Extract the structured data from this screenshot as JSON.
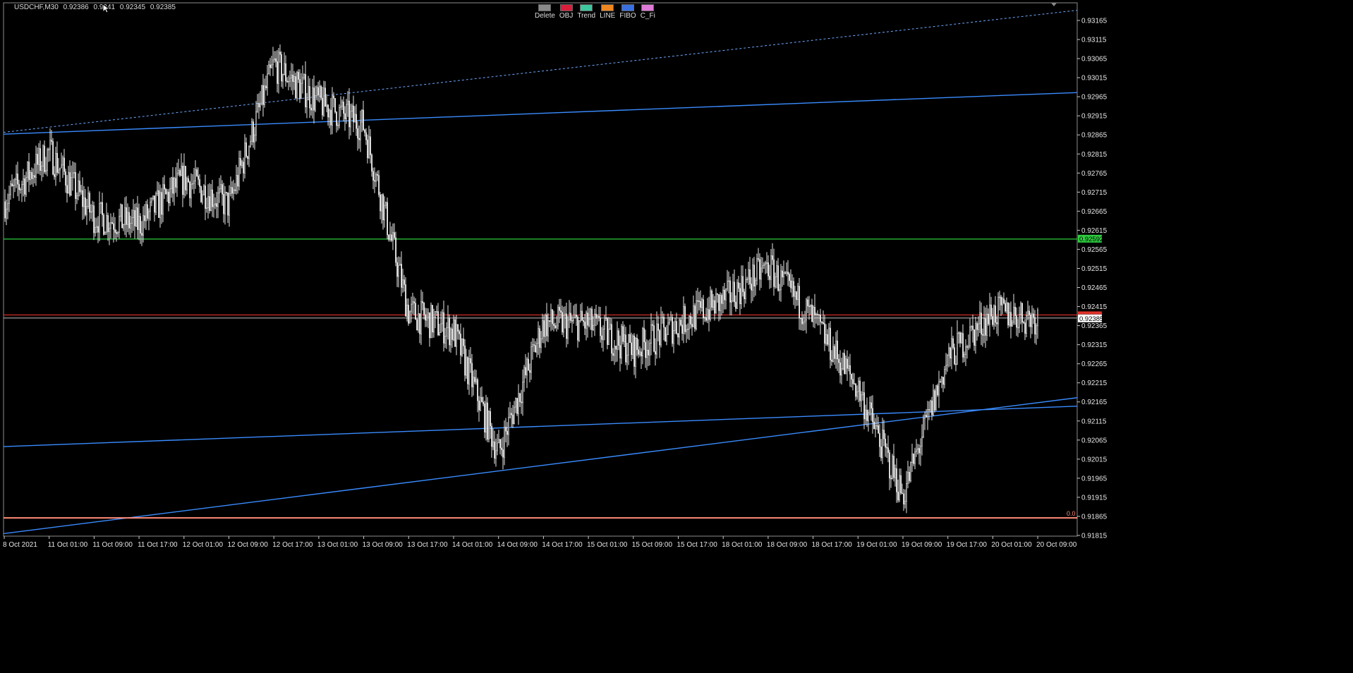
{
  "header": {
    "symbol": "USDCHF,M30",
    "prices": [
      "0.92386",
      "0.9241",
      "0.92345",
      "0.92385"
    ]
  },
  "toolbar": [
    {
      "label": "Delete",
      "color": "#8a8a8a"
    },
    {
      "label": "OBJ",
      "color": "#d81e3a"
    },
    {
      "label": "Trend",
      "color": "#3fc7a0"
    },
    {
      "label": "LINE",
      "color": "#f0861f"
    },
    {
      "label": "FIBO",
      "color": "#3a6fe0"
    },
    {
      "label": "C_Fi",
      "color": "#e07ad8"
    }
  ],
  "chart_data": {
    "type": "candlestick",
    "y_ticks": [
      "0.93165",
      "0.93115",
      "0.93065",
      "0.93015",
      "0.92965",
      "0.92915",
      "0.92865",
      "0.92815",
      "0.92765",
      "0.92715",
      "0.92665",
      "0.92615",
      "0.92565",
      "0.92515",
      "0.92465",
      "0.92415",
      "0.92365",
      "0.92315",
      "0.92265",
      "0.92215",
      "0.92165",
      "0.92115",
      "0.92065",
      "0.92015",
      "0.91965",
      "0.91915",
      "0.91865",
      "0.91815"
    ],
    "x_ticks": [
      "8 Oct 2021",
      "11 Oct 01:00",
      "11 Oct 09:00",
      "11 Oct 17:00",
      "12 Oct 01:00",
      "12 Oct 09:00",
      "12 Oct 17:00",
      "13 Oct 01:00",
      "13 Oct 09:00",
      "13 Oct 17:00",
      "14 Oct 01:00",
      "14 Oct 09:00",
      "14 Oct 17:00",
      "15 Oct 01:00",
      "15 Oct 09:00",
      "15 Oct 17:00",
      "18 Oct 01:00",
      "18 Oct 09:00",
      "18 Oct 17:00",
      "19 Oct 01:00",
      "19 Oct 09:00",
      "19 Oct 17:00",
      "20 Oct 01:00",
      "20 Oct 09:00"
    ],
    "y_range": [
      0.91815,
      0.93165
    ],
    "price_labels": {
      "green_level": "0.92592",
      "current": "0.92385"
    },
    "fibo_label": "0.0",
    "horizontal_lines": [
      {
        "price": 0.92592,
        "color": "#2ecc40"
      },
      {
        "price": 0.92393,
        "color": "#e0322a"
      },
      {
        "price": 0.92385,
        "color": "#9a9a9a"
      },
      {
        "price": 0.91861,
        "color": "#ff8c78"
      }
    ],
    "trend_lines": [
      {
        "from": [
          "8 Oct 2021",
          0.92867
        ],
        "to": [
          "20 Oct 09:00",
          0.92972
        ],
        "color": "#3a8cff"
      },
      {
        "from": [
          "8 Oct 2021",
          0.92048
        ],
        "to": [
          "20 Oct 09:00",
          0.9215
        ],
        "color": "#3a8cff"
      },
      {
        "from": [
          "8 Oct 2021",
          0.9182
        ],
        "to": [
          "20 Oct 09:00",
          0.92163
        ],
        "color": "#3a8cff"
      },
      {
        "from": [
          "8 Oct 2021",
          0.92872
        ],
        "to": [
          "20 Oct 09:00",
          0.9318
        ],
        "color": "#6fa8ff",
        "dashed": true
      }
    ],
    "path": [
      [
        "8 Oct 2021",
        0.9269
      ],
      [
        "11 Oct 01:00",
        0.9282
      ],
      [
        "11 Oct 09:00",
        0.9265
      ],
      [
        "11 Oct 17:00",
        0.9263
      ],
      [
        "12 Oct 01:00",
        0.9275
      ],
      [
        "12 Oct 09:00",
        0.9268
      ],
      [
        "12 Oct 17:00",
        0.9305
      ],
      [
        "13 Oct 01:00",
        0.9295
      ],
      [
        "13 Oct 09:00",
        0.9289
      ],
      [
        "13 Oct 17:00",
        0.924
      ],
      [
        "14 Oct 01:00",
        0.9235
      ],
      [
        "14 Oct 09:00",
        0.9203
      ],
      [
        "14 Oct 17:00",
        0.9237
      ],
      [
        "15 Oct 01:00",
        0.9237
      ],
      [
        "15 Oct 09:00",
        0.923
      ],
      [
        "15 Oct 17:00",
        0.9237
      ],
      [
        "18 Oct 01:00",
        0.9243
      ],
      [
        "18 Oct 09:00",
        0.9252
      ],
      [
        "18 Oct 17:00",
        0.9238
      ],
      [
        "19 Oct 01:00",
        0.922
      ],
      [
        "19 Oct 09:00",
        0.9192
      ],
      [
        "19 Oct 17:00",
        0.9228
      ],
      [
        "20 Oct 01:00",
        0.924
      ],
      [
        "20 Oct 09:00",
        0.92385
      ]
    ]
  }
}
